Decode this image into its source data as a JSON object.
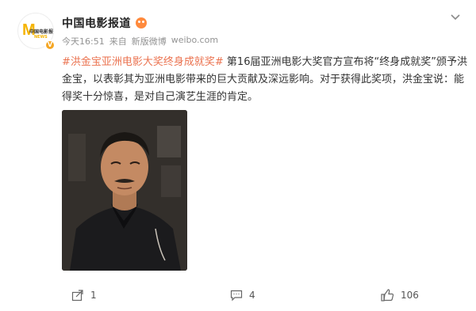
{
  "account": {
    "name": "中国电影报道",
    "avatar_logo": "M",
    "avatar_text": "中国电影报道",
    "avatar_sub": "NEWS"
  },
  "meta": {
    "time": "今天16:51",
    "source_prefix": "来自",
    "source": "新版微博",
    "via": "weibo.com"
  },
  "content": {
    "hashtag": "#洪金宝亚洲电影大奖终身成就奖#",
    "text": " 第16届亚洲电影大奖官方宣布将“终身成就奖”颁予洪金宝，以表彰其为亚洲电影带来的巨大贡献及深远影响。对于获得此奖项，洪金宝说：能得奖十分惊喜，是对自己演艺生涯的肯定。"
  },
  "footer": {
    "share_count": "1",
    "comment_count": "4",
    "like_count": "106"
  },
  "colors": {
    "hashtag": "#eb7350",
    "meta": "#939393",
    "verified": "#f5a623"
  },
  "icons": [
    "verified-icon",
    "emoji-badge-icon",
    "chevron-down-icon",
    "share-icon",
    "comment-icon",
    "like-icon"
  ]
}
